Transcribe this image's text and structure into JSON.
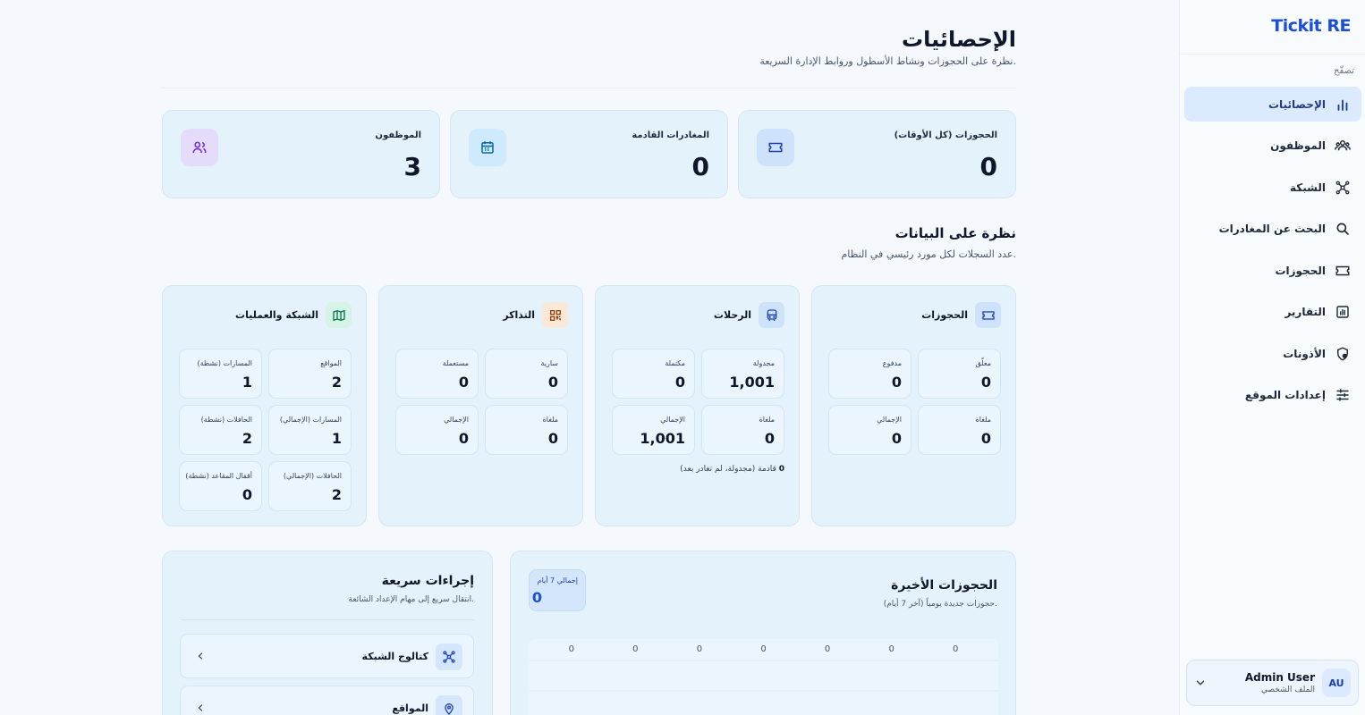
{
  "app": {
    "brand": "Tickit RE"
  },
  "sidebar": {
    "caption": "تصفّح",
    "items": [
      {
        "label": "الإحصائيات",
        "icon": "bar-chart-icon"
      },
      {
        "label": "الموظفون",
        "icon": "users-icon"
      },
      {
        "label": "الشبكة",
        "icon": "network-icon"
      },
      {
        "label": "البحث عن المغادرات",
        "icon": "search-icon"
      },
      {
        "label": "الحجوزات",
        "icon": "ticket-icon"
      },
      {
        "label": "التقارير",
        "icon": "report-icon"
      },
      {
        "label": "الأذونات",
        "icon": "shield-icon"
      },
      {
        "label": "إعدادات الموقع",
        "icon": "sliders-icon"
      }
    ],
    "user": {
      "initials": "AU",
      "name": "Admin User",
      "subtitle": "الملف الشخصي"
    }
  },
  "header": {
    "title": "الإحصائيات",
    "subtitle": "نظرة على الحجوزات ونشاط الأسطول وروابط الإدارة السريعة."
  },
  "stats": [
    {
      "label": "الحجوزات (كل الأوقات)",
      "value": "0",
      "icon": "ticket-icon"
    },
    {
      "label": "المغادرات القادمة",
      "value": "0",
      "icon": "calendar-icon"
    },
    {
      "label": "الموظفون",
      "value": "3",
      "icon": "users-icon"
    }
  ],
  "overview": {
    "title": "نظرة على البيانات",
    "subtitle": "عدد السجلات لكل مورد رئيسي في النظام.",
    "cards": [
      {
        "title": "الحجوزات",
        "icon": "ticket-icon",
        "cells": [
          {
            "label": "معلّق",
            "value": "0"
          },
          {
            "label": "مدفوع",
            "value": "0"
          },
          {
            "label": "ملغاة",
            "value": "0"
          },
          {
            "label": "الإجمالي",
            "value": "0"
          }
        ]
      },
      {
        "title": "الرحلات",
        "icon": "bus-icon",
        "cells": [
          {
            "label": "مجدولة",
            "value": "1,001"
          },
          {
            "label": "مكتملة",
            "value": "0"
          },
          {
            "label": "ملغاة",
            "value": "0"
          },
          {
            "label": "الإجمالي",
            "value": "1,001"
          }
        ],
        "note_value": "0",
        "note_text": "قادمة (مجدولة، لم تغادر بعد)"
      },
      {
        "title": "التذاكر",
        "icon": "qr-icon",
        "cells": [
          {
            "label": "سارية",
            "value": "0"
          },
          {
            "label": "مستعملة",
            "value": "0"
          },
          {
            "label": "ملغاة",
            "value": "0"
          },
          {
            "label": "الإجمالي",
            "value": "0"
          }
        ]
      },
      {
        "title": "الشبكة والعمليات",
        "icon": "map-icon",
        "cells": [
          {
            "label": "المواقع",
            "value": "2"
          },
          {
            "label": "المسارات (نشطة)",
            "value": "1"
          },
          {
            "label": "المسارات (الإجمالي)",
            "value": "1"
          },
          {
            "label": "الحافلات (نشطة)",
            "value": "2"
          },
          {
            "label": "الحافلات (الإجمالي)",
            "value": "2"
          },
          {
            "label": "أقفال المقاعد (نشطة)",
            "value": "0"
          }
        ]
      }
    ]
  },
  "recent": {
    "title": "الحجوزات الأخيرة",
    "subtitle": "حجوزات جديدة يومياً (آخر 7 أيام).",
    "total_label": "إجمالي 7 أيام",
    "total_value": "0",
    "chart_data": {
      "type": "bar",
      "values": [
        0,
        0,
        0,
        0,
        0,
        0,
        0
      ],
      "data_labels": [
        "0",
        "0",
        "0",
        "0",
        "0",
        "0",
        "0"
      ]
    }
  },
  "quick": {
    "title": "إجراءات سريعة",
    "subtitle": "انتقال سريع إلى مهام الإعداد الشائعة.",
    "links": [
      {
        "label": "كتالوج الشبكة",
        "icon": "network-icon"
      },
      {
        "label": "المواقع",
        "icon": "location-pin-icon"
      }
    ]
  },
  "colors": {
    "accent": "#1d4ed8",
    "card_bg": "#e4f2fc",
    "active_nav": "#dbeafe",
    "purple_icon_bg": "#e5dcfb",
    "orange_icon_bg": "#fbe9d8"
  }
}
